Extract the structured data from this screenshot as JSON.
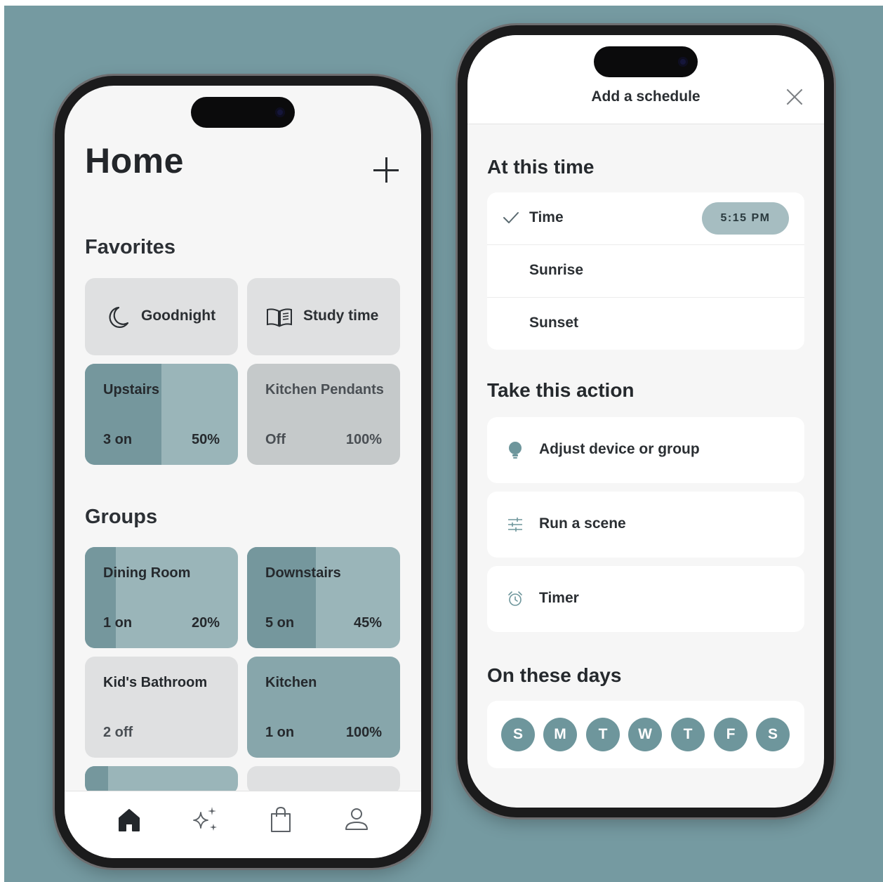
{
  "colors": {
    "background": "#759aa1",
    "group_tile": "#9ab5b9",
    "group_fill": "#75979d",
    "day_chip": "#6e969c",
    "time_pill": "#a6bdc1"
  },
  "home": {
    "title": "Home",
    "add_icon": "plus-icon",
    "favorites_title": "Favorites",
    "favorites": [
      {
        "label": "Goodnight",
        "icon": "moon-icon"
      },
      {
        "label": "Study time",
        "icon": "book-icon"
      }
    ],
    "favorite_groups": [
      {
        "name": "Upstairs",
        "state": "3 on",
        "brightness": "50%",
        "fill_fraction": 0.5
      },
      {
        "name": "Kitchen Pendants",
        "state": "Off",
        "brightness": "100%",
        "fill_fraction": 0
      }
    ],
    "groups_title": "Groups",
    "groups": [
      {
        "name": "Dining Room",
        "state": "1 on",
        "brightness": "20%",
        "fill_fraction": 0.2
      },
      {
        "name": "Downstairs",
        "state": "5 on",
        "brightness": "45%",
        "fill_fraction": 0.45
      },
      {
        "name": "Kid's Bathroom",
        "state": "2 off",
        "brightness": "",
        "fill_fraction": 0
      },
      {
        "name": "Kitchen",
        "state": "1 on",
        "brightness": "100%",
        "fill_fraction": 1
      }
    ],
    "tabs": [
      {
        "name": "home",
        "icon": "home-icon"
      },
      {
        "name": "scenes",
        "icon": "sparkles-icon"
      },
      {
        "name": "shop",
        "icon": "shopping-bag-icon"
      },
      {
        "name": "profile",
        "icon": "person-icon"
      }
    ]
  },
  "schedule": {
    "title": "Add a schedule",
    "close_icon": "close-icon",
    "time_section": "At this time",
    "time_options": [
      {
        "label": "Time",
        "selected": true,
        "value": "5:15 PM"
      },
      {
        "label": "Sunrise",
        "selected": false
      },
      {
        "label": "Sunset",
        "selected": false
      }
    ],
    "action_section": "Take this action",
    "actions": [
      {
        "label": "Adjust device or group",
        "icon": "bulb-icon"
      },
      {
        "label": "Run a scene",
        "icon": "sliders-icon"
      },
      {
        "label": "Timer",
        "icon": "alarm-clock-icon"
      }
    ],
    "days_section": "On these days",
    "days": [
      "S",
      "M",
      "T",
      "W",
      "T",
      "F",
      "S"
    ]
  }
}
